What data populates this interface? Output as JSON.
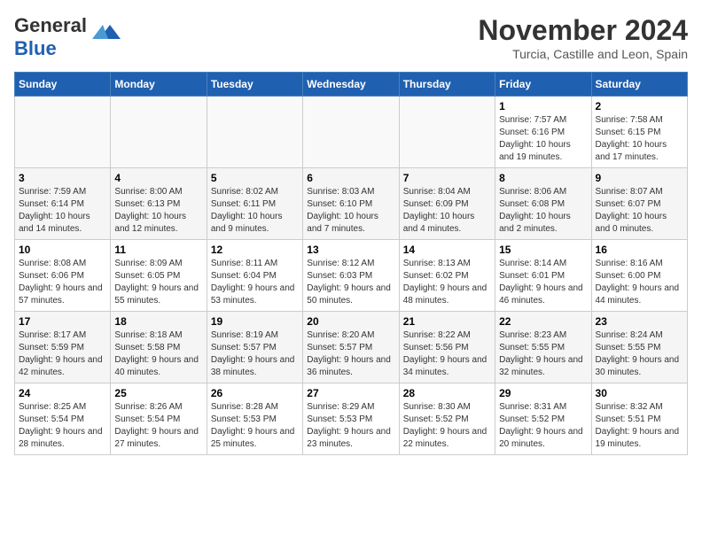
{
  "logo": {
    "general": "General",
    "blue": "Blue"
  },
  "header": {
    "month": "November 2024",
    "location": "Turcia, Castille and Leon, Spain"
  },
  "days_of_week": [
    "Sunday",
    "Monday",
    "Tuesday",
    "Wednesday",
    "Thursday",
    "Friday",
    "Saturday"
  ],
  "weeks": [
    {
      "days": [
        {
          "num": "",
          "data": ""
        },
        {
          "num": "",
          "data": ""
        },
        {
          "num": "",
          "data": ""
        },
        {
          "num": "",
          "data": ""
        },
        {
          "num": "",
          "data": ""
        },
        {
          "num": "1",
          "data": "Sunrise: 7:57 AM\nSunset: 6:16 PM\nDaylight: 10 hours and 19 minutes."
        },
        {
          "num": "2",
          "data": "Sunrise: 7:58 AM\nSunset: 6:15 PM\nDaylight: 10 hours and 17 minutes."
        }
      ]
    },
    {
      "days": [
        {
          "num": "3",
          "data": "Sunrise: 7:59 AM\nSunset: 6:14 PM\nDaylight: 10 hours and 14 minutes."
        },
        {
          "num": "4",
          "data": "Sunrise: 8:00 AM\nSunset: 6:13 PM\nDaylight: 10 hours and 12 minutes."
        },
        {
          "num": "5",
          "data": "Sunrise: 8:02 AM\nSunset: 6:11 PM\nDaylight: 10 hours and 9 minutes."
        },
        {
          "num": "6",
          "data": "Sunrise: 8:03 AM\nSunset: 6:10 PM\nDaylight: 10 hours and 7 minutes."
        },
        {
          "num": "7",
          "data": "Sunrise: 8:04 AM\nSunset: 6:09 PM\nDaylight: 10 hours and 4 minutes."
        },
        {
          "num": "8",
          "data": "Sunrise: 8:06 AM\nSunset: 6:08 PM\nDaylight: 10 hours and 2 minutes."
        },
        {
          "num": "9",
          "data": "Sunrise: 8:07 AM\nSunset: 6:07 PM\nDaylight: 10 hours and 0 minutes."
        }
      ]
    },
    {
      "days": [
        {
          "num": "10",
          "data": "Sunrise: 8:08 AM\nSunset: 6:06 PM\nDaylight: 9 hours and 57 minutes."
        },
        {
          "num": "11",
          "data": "Sunrise: 8:09 AM\nSunset: 6:05 PM\nDaylight: 9 hours and 55 minutes."
        },
        {
          "num": "12",
          "data": "Sunrise: 8:11 AM\nSunset: 6:04 PM\nDaylight: 9 hours and 53 minutes."
        },
        {
          "num": "13",
          "data": "Sunrise: 8:12 AM\nSunset: 6:03 PM\nDaylight: 9 hours and 50 minutes."
        },
        {
          "num": "14",
          "data": "Sunrise: 8:13 AM\nSunset: 6:02 PM\nDaylight: 9 hours and 48 minutes."
        },
        {
          "num": "15",
          "data": "Sunrise: 8:14 AM\nSunset: 6:01 PM\nDaylight: 9 hours and 46 minutes."
        },
        {
          "num": "16",
          "data": "Sunrise: 8:16 AM\nSunset: 6:00 PM\nDaylight: 9 hours and 44 minutes."
        }
      ]
    },
    {
      "days": [
        {
          "num": "17",
          "data": "Sunrise: 8:17 AM\nSunset: 5:59 PM\nDaylight: 9 hours and 42 minutes."
        },
        {
          "num": "18",
          "data": "Sunrise: 8:18 AM\nSunset: 5:58 PM\nDaylight: 9 hours and 40 minutes."
        },
        {
          "num": "19",
          "data": "Sunrise: 8:19 AM\nSunset: 5:57 PM\nDaylight: 9 hours and 38 minutes."
        },
        {
          "num": "20",
          "data": "Sunrise: 8:20 AM\nSunset: 5:57 PM\nDaylight: 9 hours and 36 minutes."
        },
        {
          "num": "21",
          "data": "Sunrise: 8:22 AM\nSunset: 5:56 PM\nDaylight: 9 hours and 34 minutes."
        },
        {
          "num": "22",
          "data": "Sunrise: 8:23 AM\nSunset: 5:55 PM\nDaylight: 9 hours and 32 minutes."
        },
        {
          "num": "23",
          "data": "Sunrise: 8:24 AM\nSunset: 5:55 PM\nDaylight: 9 hours and 30 minutes."
        }
      ]
    },
    {
      "days": [
        {
          "num": "24",
          "data": "Sunrise: 8:25 AM\nSunset: 5:54 PM\nDaylight: 9 hours and 28 minutes."
        },
        {
          "num": "25",
          "data": "Sunrise: 8:26 AM\nSunset: 5:54 PM\nDaylight: 9 hours and 27 minutes."
        },
        {
          "num": "26",
          "data": "Sunrise: 8:28 AM\nSunset: 5:53 PM\nDaylight: 9 hours and 25 minutes."
        },
        {
          "num": "27",
          "data": "Sunrise: 8:29 AM\nSunset: 5:53 PM\nDaylight: 9 hours and 23 minutes."
        },
        {
          "num": "28",
          "data": "Sunrise: 8:30 AM\nSunset: 5:52 PM\nDaylight: 9 hours and 22 minutes."
        },
        {
          "num": "29",
          "data": "Sunrise: 8:31 AM\nSunset: 5:52 PM\nDaylight: 9 hours and 20 minutes."
        },
        {
          "num": "30",
          "data": "Sunrise: 8:32 AM\nSunset: 5:51 PM\nDaylight: 9 hours and 19 minutes."
        }
      ]
    }
  ]
}
